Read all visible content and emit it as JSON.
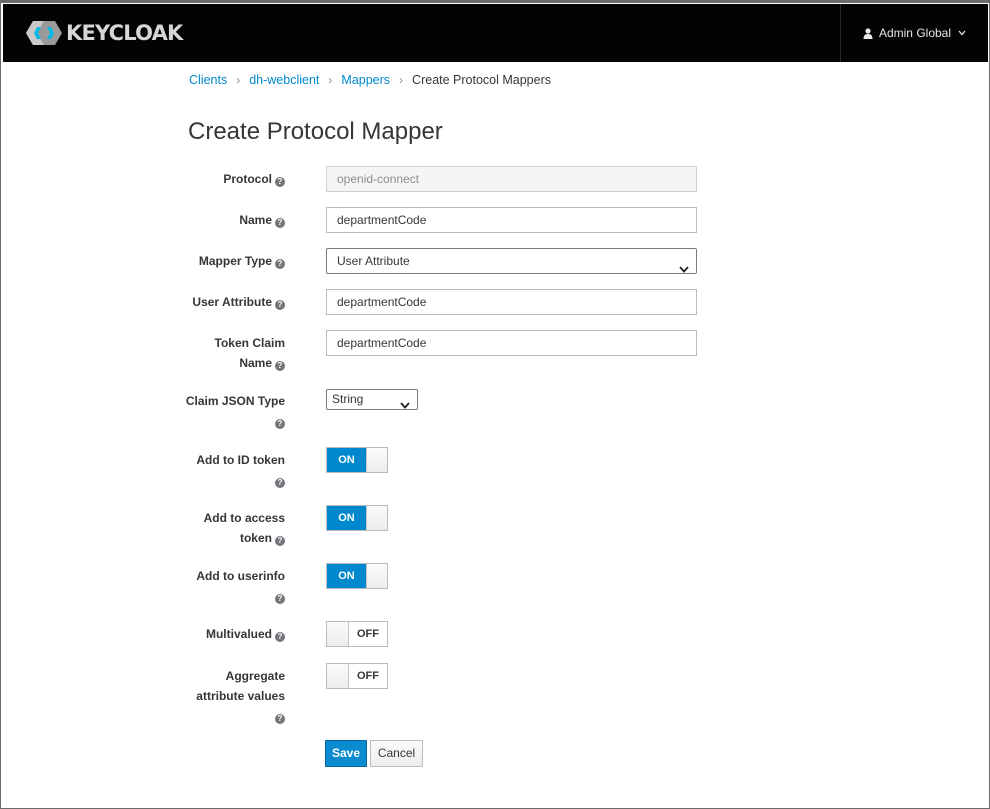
{
  "header": {
    "logo_text": "KEYCLOAK",
    "user_name": "Admin Global"
  },
  "breadcrumb": [
    {
      "label": "Clients",
      "link": true
    },
    {
      "label": "dh-webclient",
      "link": true
    },
    {
      "label": "Mappers",
      "link": true
    },
    {
      "label": "Create Protocol Mappers",
      "link": false
    }
  ],
  "page_title": "Create Protocol Mapper",
  "form": {
    "protocol": {
      "label": "Protocol",
      "value": "openid-connect"
    },
    "name": {
      "label": "Name",
      "value": "departmentCode"
    },
    "mapper_type": {
      "label": "Mapper Type",
      "value": "User Attribute"
    },
    "user_attribute": {
      "label": "User Attribute",
      "value": "departmentCode"
    },
    "token_claim_name": {
      "label_line1": "Token Claim",
      "label_line2": "Name",
      "value": "departmentCode"
    },
    "claim_json_type": {
      "label_line1": "Claim JSON Type",
      "value": "String"
    },
    "add_to_id_token": {
      "label_line1": "Add to ID token",
      "state": "ON"
    },
    "add_to_access_token": {
      "label_line1": "Add to access",
      "label_line2": "token",
      "state": "ON"
    },
    "add_to_userinfo": {
      "label_line1": "Add to userinfo",
      "state": "ON"
    },
    "multivalued": {
      "label": "Multivalued",
      "state": "OFF"
    },
    "aggregate": {
      "label_line1": "Aggregate",
      "label_line2": "attribute values",
      "state": "OFF"
    }
  },
  "buttons": {
    "save": "Save",
    "cancel": "Cancel"
  },
  "colors": {
    "accent": "#0088ce",
    "header_bg": "#030303"
  }
}
